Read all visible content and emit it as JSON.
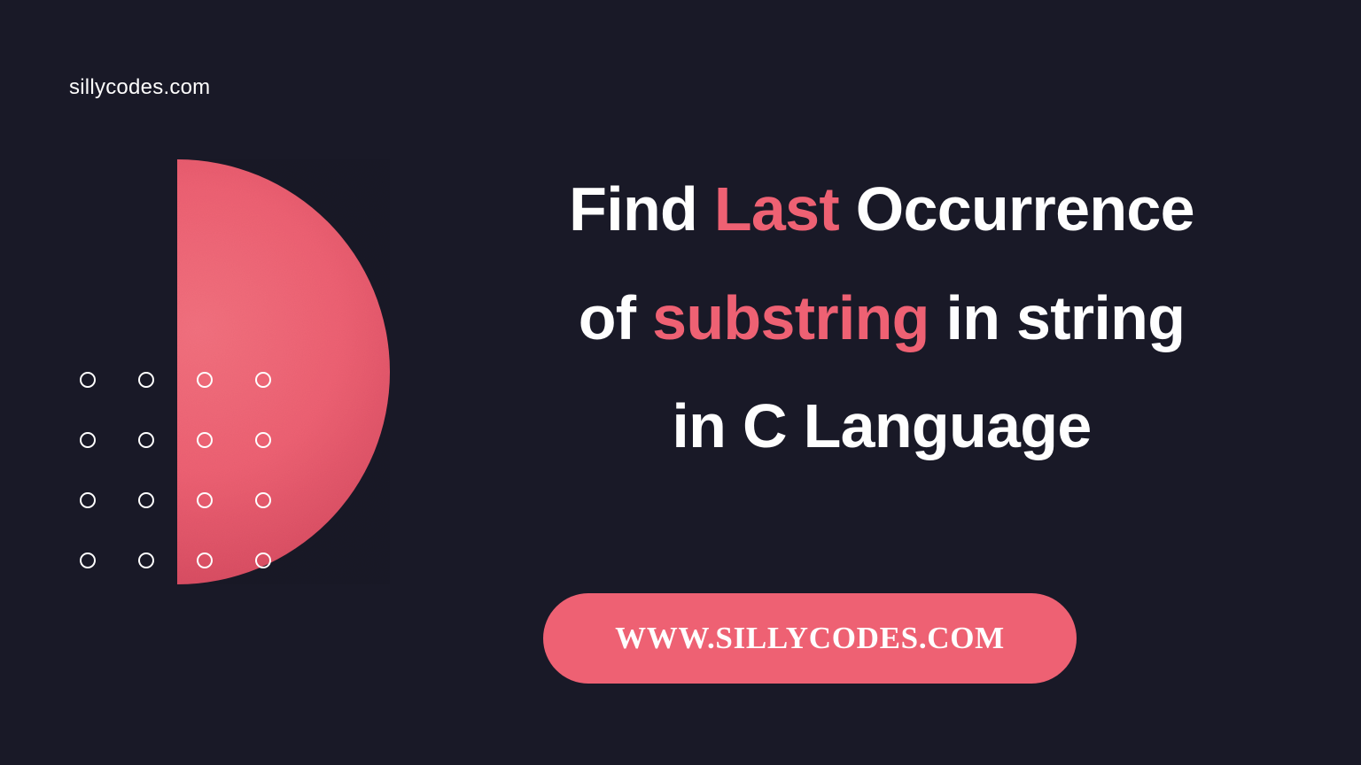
{
  "site_label": "sillycodes.com",
  "title": {
    "part1": "Find",
    "accent1": "Last",
    "part2": "Occurrence",
    "part3": "of",
    "accent2": "substring",
    "part4": "in string",
    "part5": "in C Language"
  },
  "pill_label": "WWW.SILLYCODES.COM",
  "colors": {
    "background": "#191927",
    "accent": "#ee6173",
    "text": "#fefefe"
  }
}
